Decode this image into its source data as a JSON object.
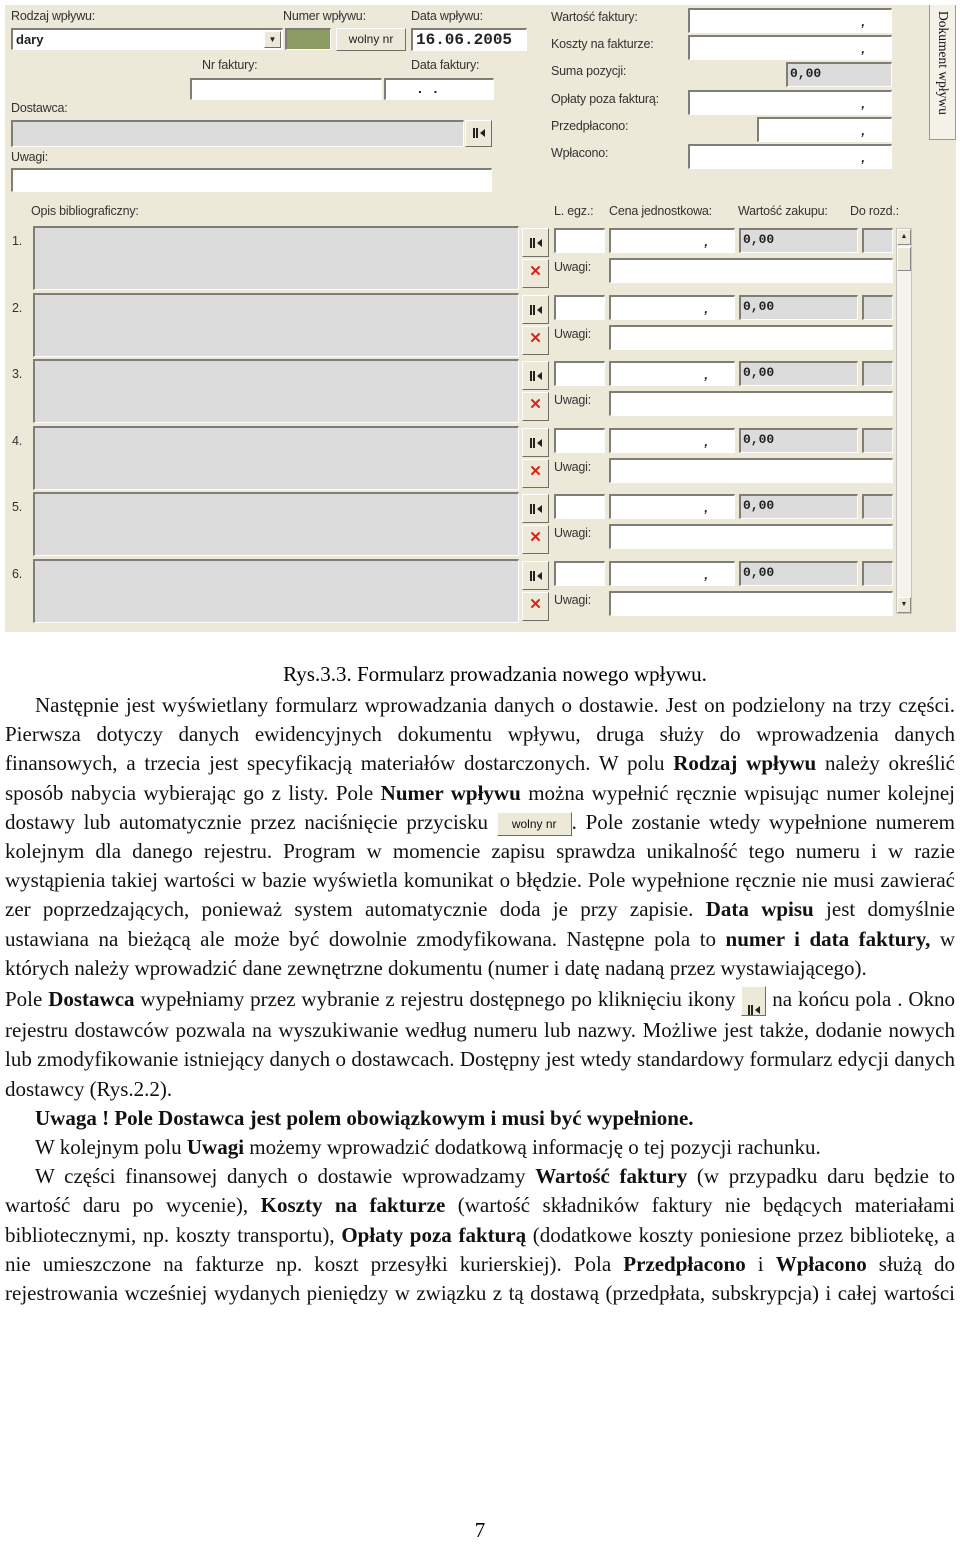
{
  "form": {
    "rodzaj_label": "Rodzaj wpływu:",
    "rodzaj_value": "dary",
    "numer_label": "Numer wpływu:",
    "wolny_nr_button": "wolny nr",
    "data_wplywu_label": "Data wpływu:",
    "data_wplywu_value": "16.06.2005",
    "nr_faktury_label": "Nr faktury:",
    "data_faktury_label": "Data faktury:",
    "data_faktury_value": ".   .",
    "dostawca_label": "Dostawca:",
    "uwagi_label": "Uwagi:",
    "opis_label": "Opis bibliograficzny:",
    "finance": [
      {
        "label": "Wartość faktury:",
        "value": ","
      },
      {
        "label": "Koszty na fakturze:",
        "value": ","
      },
      {
        "label": "Suma pozycji:",
        "value": "0,00"
      },
      {
        "label": "Opłaty poza fakturą:",
        "value": ","
      },
      {
        "label": "Przedpłacono:",
        "value": ","
      },
      {
        "label": "Wpłacono:",
        "value": ","
      }
    ],
    "columns": {
      "legz": "L. egz.:",
      "cena": "Cena jednostkowa:",
      "wartosc": "Wartość zakupu:",
      "dorozd": "Do rozd.:"
    },
    "rows": [
      {
        "num": "1.",
        "cena": ",",
        "wartosc": "0,00",
        "uwagi_label": "Uwagi:"
      },
      {
        "num": "2.",
        "cena": ",",
        "wartosc": "0,00",
        "uwagi_label": "Uwagi:"
      },
      {
        "num": "3.",
        "cena": ",",
        "wartosc": "0,00",
        "uwagi_label": "Uwagi:"
      },
      {
        "num": "4.",
        "cena": ",",
        "wartosc": "0,00",
        "uwagi_label": "Uwagi:"
      },
      {
        "num": "5.",
        "cena": ",",
        "wartosc": "0,00",
        "uwagi_label": "Uwagi:"
      },
      {
        "num": "6.",
        "cena": ",",
        "wartosc": "0,00",
        "uwagi_label": "Uwagi:"
      }
    ],
    "tab_label": "Dokument wpływu",
    "icons": {
      "select": "select-from-register-icon",
      "delete": "delete-x-icon",
      "dropdown": "chevron-down-icon"
    },
    "colors": {
      "background": "#ece9d8",
      "numer_field": "#8c9a63",
      "delete": "#d2261f"
    }
  },
  "caption": "Rys.3.3. Formularz prowadzania nowego wpływu.",
  "paragraphs": [
    {
      "indent": true,
      "runs": [
        {
          "t": "Następnie jest wyświetlany formularz wprowadzania danych o dostawie. Jest on podzielony na trzy części. Pierwsza dotyczy danych ewidencyjnych dokumentu wpływu, druga służy do wprowadzenia danych finansowych, a trzecia jest specyfikacją materiałów dostarczonych. W polu "
        },
        {
          "t": "Rodzaj wpływu",
          "b": true
        },
        {
          "t": " należy określić sposób nabycia  wybierając go z listy. Pole "
        },
        {
          "t": "Numer wpływu",
          "b": true
        },
        {
          "t": " można wypełnić ręcznie wpisując numer   kolejnej dostawy lub automatycznie przez naciśnięcie przycisku "
        },
        {
          "button": "wolny nr"
        },
        {
          "t": ". Pole zostanie wtedy wypełnione numerem kolejnym dla danego rejestru. Program w momencie zapisu sprawdza unikalność tego numeru i w razie wystąpienia takiej wartości w bazie wyświetla komunikat o błędzie. Pole wypełnione ręcznie nie musi zawierać zer poprzedzających, ponieważ system automatycznie doda je przy zapisie. "
        },
        {
          "t": "Data wpisu",
          "b": true
        },
        {
          "t": " jest domyślnie ustawiana na bieżącą ale może być dowolnie zmodyfikowana. Następne pola to "
        },
        {
          "t": "numer i data faktury,",
          "b": true
        },
        {
          "t": " w których należy wprowadzić dane zewnętrzne dokumentu (numer i datę nadaną przez wystawiającego)."
        }
      ]
    },
    {
      "indent": false,
      "runs": [
        {
          "t": "Pole  "
        },
        {
          "t": "Dostawca",
          "b": true
        },
        {
          "t": " wypełniamy przez wybranie z rejestru dostępnego po kliknięciu ikony "
        },
        {
          "icon": "select-from-register-icon"
        },
        {
          "t": " na końcu pola . Okno rejestru dostawców pozwala na wyszukiwanie według numeru lub nazwy. Możliwe jest także, dodanie nowych lub zmodyfikowanie istniejący danych o dostawcach. Dostępny jest wtedy standardowy formularz edycji danych dostawcy (Rys.2.2)."
        }
      ]
    },
    {
      "indent": true,
      "runs": [
        {
          "t": "Uwaga ! Pole Dostawca jest polem obowiązkowym i musi być wypełnione.",
          "b": true
        }
      ]
    },
    {
      "indent": true,
      "runs": [
        {
          "t": "W kolejnym polu "
        },
        {
          "t": "Uwagi",
          "b": true
        },
        {
          "t": " możemy wprowadzić dodatkową informację o tej pozycji rachunku."
        }
      ]
    },
    {
      "indent": true,
      "last": true,
      "runs": [
        {
          "t": "W części finansowej danych o dostawie wprowadzamy "
        },
        {
          "t": "Wartość faktury",
          "b": true
        },
        {
          "t": " (w przypadku daru będzie to wartość daru po wycenie), "
        },
        {
          "t": "Koszty na fakturze",
          "b": true
        },
        {
          "t": " (wartość składników faktury nie będących materiałami bibliotecznymi, np. koszty transportu), "
        },
        {
          "t": "Opłaty poza fakturą",
          "b": true
        },
        {
          "t": " (dodatkowe koszty poniesione przez bibliotekę, a nie umieszczone na fakturze np. koszt przesyłki kurierskiej). Pola "
        },
        {
          "t": "Przedpłacono",
          "b": true
        },
        {
          "t": " i "
        },
        {
          "t": "Wpłacono",
          "b": true
        },
        {
          "t": " służą do rejestrowania wcześniej wydanych pieniędzy w związku z tą dostawą (przedpłata, subskrypcja) i całej wartości"
        }
      ]
    }
  ],
  "page_number": "7"
}
